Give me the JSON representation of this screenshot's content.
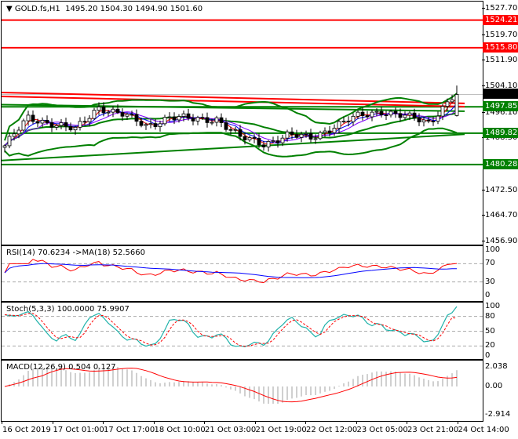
{
  "header": {
    "symbol": "GOLD.fs,H1",
    "open": "1495.20",
    "high": "1504.30",
    "low": "1494.90",
    "close": "1501.60"
  },
  "price_axis": [
    "1527.70",
    "1519.70",
    "1511.90",
    "1504.10",
    "1496.10",
    "1488.30",
    "1472.50",
    "1464.70",
    "1456.90"
  ],
  "levels": [
    {
      "value": 1524.21,
      "label": "1524.21",
      "color": "#ff0000"
    },
    {
      "value": 1515.8,
      "label": "1515.80",
      "color": "#ff0000"
    },
    {
      "value": 1497.85,
      "label": "1497.85",
      "color": "#008000"
    },
    {
      "value": 1489.82,
      "label": "1489.82",
      "color": "#008000"
    },
    {
      "value": 1480.28,
      "label": "1480.28",
      "color": "#008000"
    }
  ],
  "current_price": {
    "value": 1501.6,
    "label": "1501.60"
  },
  "trendlines": [
    {
      "from": 1502.2,
      "to": 1498.9,
      "color": "#ff0000"
    },
    {
      "from": 1501.0,
      "to": 1497.9,
      "color": "#ff0000"
    },
    {
      "from": 1498.5,
      "to": 1496.5,
      "color": "#008000"
    },
    {
      "from": 1481.5,
      "to": 1489.5,
      "color": "#008000"
    }
  ],
  "chart_data": {
    "type": "candlestick",
    "close_anchors": [
      1486,
      1494.3,
      1493,
      1490.7,
      1497.9,
      1495.5,
      1492,
      1494.8,
      1493.9,
      1494.3,
      1488.4,
      1486.7,
      1489.1,
      1488.4,
      1492,
      1494.8,
      1496.7,
      1494.8,
      1493.1,
      1500.8
    ],
    "last_candle": {
      "open": 1495.2,
      "high": 1504.3,
      "low": 1494.9,
      "close": 1501.6
    },
    "ylim": [
      1456.9,
      1527.7
    ]
  },
  "rsi": {
    "title": "RSI(14) 70.6234  ->MA(18) 52.5660",
    "axis": [
      "100",
      "70",
      "30",
      "0"
    ]
  },
  "stoch": {
    "title": "Stoch(5,3,3) 100.0000 75.9907",
    "axis": [
      "100",
      "80",
      "50",
      "20",
      "0"
    ]
  },
  "macd": {
    "title": "MACD(12,26,9) 0.504 0.127",
    "axis": [
      "2.038",
      "0.00",
      "-2.914"
    ]
  },
  "time_axis": [
    "16 Oct 2019",
    "17 Oct 01:00",
    "17 Oct 17:00",
    "18 Oct 10:00",
    "21 Oct 03:00",
    "21 Oct 19:00",
    "22 Oct 12:00",
    "23 Oct 05:00",
    "23 Oct 21:00",
    "24 Oct 14:00"
  ],
  "colors": {
    "bull": "#00aa00",
    "bear": "#000000",
    "bands": "#008000",
    "rsi": "#ff0000",
    "rsi_ma": "#0000ff",
    "stoch_main": "#20b2aa",
    "stoch_signal": "#ff0000",
    "macd_hist": "#a0a0a0",
    "macd_signal": "#ff0000"
  }
}
